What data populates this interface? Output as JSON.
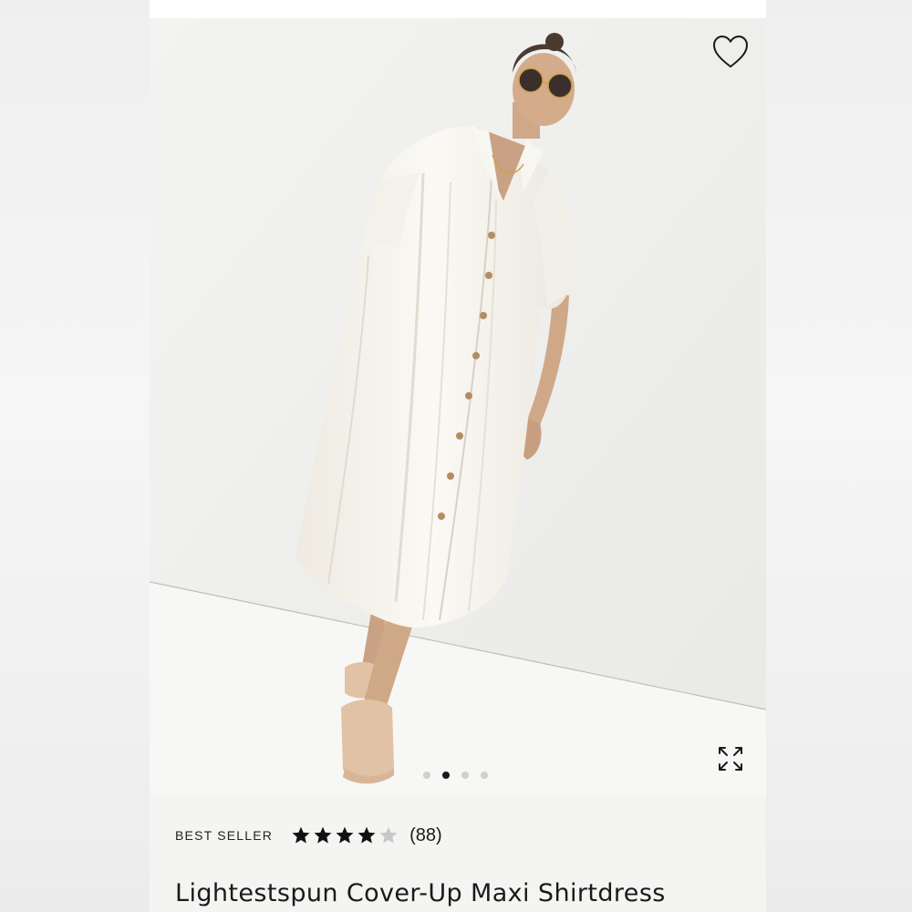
{
  "product": {
    "badge": "BEST SELLER",
    "rating": 4,
    "rating_max": 5,
    "review_count": "(88)",
    "title": "Lightestspun Cover-Up Maxi Shirtdress"
  },
  "gallery": {
    "image_alt": "Lightestspun Cover-Up Maxi Shirtdress",
    "slide_count": 4,
    "active_slide": 2
  },
  "icons": {
    "favorite": "heart-outline-icon",
    "expand": "expand-arrows-icon",
    "star_filled": "star-filled-icon",
    "star_empty": "star-empty-icon"
  },
  "colors": {
    "background": "#f2f2f2",
    "card": "#ffffff",
    "info_panel": "#f4f4f2",
    "text": "#1a1a1a",
    "star_filled": "#111111",
    "star_empty": "#c8c8c8",
    "dot_active": "#1a1a1a",
    "dot_inactive": "#cfcfcf",
    "sandal": "#e2c2a4"
  }
}
